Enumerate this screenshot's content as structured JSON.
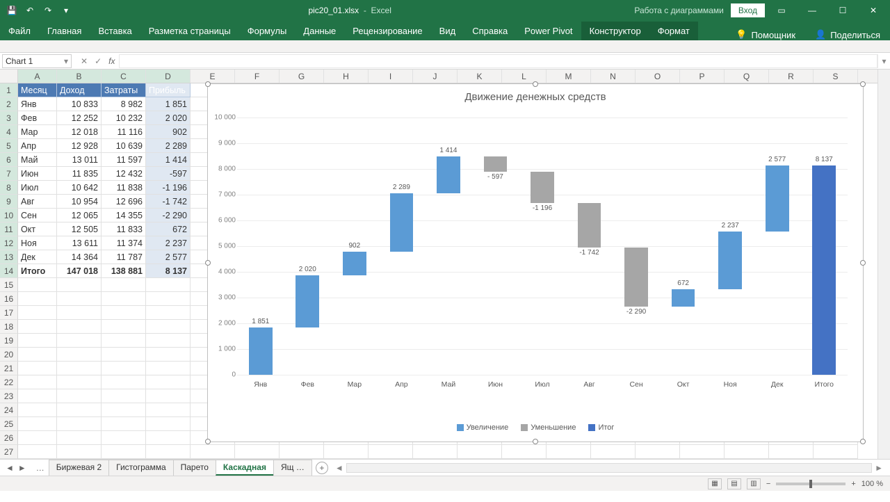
{
  "titlebar": {
    "filename": "pic20_01.xlsx",
    "app": "Excel",
    "chart_tools": "Работа с диаграммами",
    "login": "Вход"
  },
  "ribbon": {
    "tabs": [
      "Файл",
      "Главная",
      "Вставка",
      "Разметка страницы",
      "Формулы",
      "Данные",
      "Рецензирование",
      "Вид",
      "Справка",
      "Power Pivot"
    ],
    "ctx_tabs": [
      "Конструктор",
      "Формат"
    ],
    "tell_me": "Помощник",
    "share": "Поделиться"
  },
  "name_box": "Chart 1",
  "columns": [
    "A",
    "B",
    "C",
    "D",
    "E",
    "F",
    "G",
    "H",
    "I",
    "J",
    "K",
    "L",
    "M",
    "N",
    "O",
    "P",
    "Q",
    "R",
    "S"
  ],
  "table": {
    "headers": [
      "Месяц",
      "Доход",
      "Затраты",
      "Прибыль"
    ],
    "rows": [
      [
        "Янв",
        "10 833",
        "8 982",
        "1 851"
      ],
      [
        "Фев",
        "12 252",
        "10 232",
        "2 020"
      ],
      [
        "Мар",
        "12 018",
        "11 116",
        "902"
      ],
      [
        "Апр",
        "12 928",
        "10 639",
        "2 289"
      ],
      [
        "Май",
        "13 011",
        "11 597",
        "1 414"
      ],
      [
        "Июн",
        "11 835",
        "12 432",
        "-597"
      ],
      [
        "Июл",
        "10 642",
        "11 838",
        "-1 196"
      ],
      [
        "Авг",
        "10 954",
        "12 696",
        "-1 742"
      ],
      [
        "Сен",
        "12 065",
        "14 355",
        "-2 290"
      ],
      [
        "Окт",
        "12 505",
        "11 833",
        "672"
      ],
      [
        "Ноя",
        "13 611",
        "11 374",
        "2 237"
      ],
      [
        "Дек",
        "14 364",
        "11 787",
        "2 577"
      ],
      [
        "Итого",
        "147 018",
        "138 881",
        "8 137"
      ]
    ]
  },
  "chart_data": {
    "type": "waterfall",
    "title": "Движение денежных средств",
    "categories": [
      "Янв",
      "Фев",
      "Мар",
      "Апр",
      "Май",
      "Июн",
      "Июл",
      "Авг",
      "Сен",
      "Окт",
      "Ноя",
      "Дек",
      "Итого"
    ],
    "values": [
      1851,
      2020,
      902,
      2289,
      1414,
      -597,
      -1196,
      -1742,
      -2290,
      672,
      2237,
      2577,
      8137
    ],
    "labels": [
      "1 851",
      "2 020",
      "902",
      "2 289",
      "1 414",
      "- 597",
      "-1 196",
      "-1 742",
      "-2 290",
      "672",
      "2 237",
      "2 577",
      "8 137"
    ],
    "is_total": [
      false,
      false,
      false,
      false,
      false,
      false,
      false,
      false,
      false,
      false,
      false,
      false,
      true
    ],
    "ylim": [
      0,
      10000
    ],
    "y_ticks": [
      0,
      1000,
      2000,
      3000,
      4000,
      5000,
      6000,
      7000,
      8000,
      9000,
      10000
    ],
    "y_tick_labels": [
      "0",
      "1 000",
      "2 000",
      "3 000",
      "4 000",
      "5 000",
      "6 000",
      "7 000",
      "8 000",
      "9 000",
      "10 000"
    ],
    "legend": [
      "Увеличение",
      "Уменьшение",
      "Итог"
    ]
  },
  "sheet_tabs": {
    "hidden_left": "…",
    "tabs": [
      "Биржевая 2",
      "Гистограмма",
      "Парето",
      "Каскадная",
      "Ящ …"
    ],
    "active": "Каскадная"
  },
  "status": {
    "zoom": "100 %"
  }
}
